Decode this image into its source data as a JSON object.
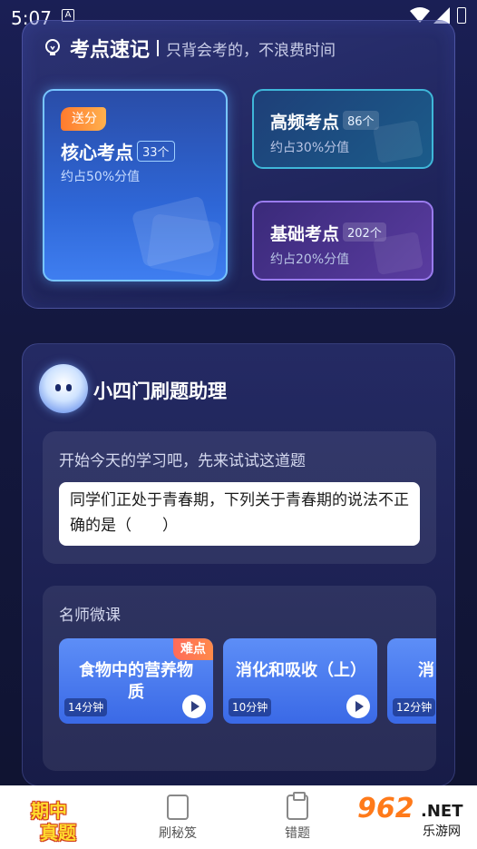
{
  "status_bar": {
    "time": "5:07",
    "notification_icon": "A"
  },
  "quick_memo": {
    "title": "考点速记",
    "subtitle": "只背会考的，不浪费时间",
    "core": {
      "badge": "送分",
      "title": "核心考点",
      "count": "33个",
      "desc": "约占50%分值"
    },
    "high_freq": {
      "title": "高频考点",
      "count": "86个",
      "desc": "约占30%分值"
    },
    "basic": {
      "title": "基础考点",
      "count": "202个",
      "desc": "约占20%分值"
    }
  },
  "assistant": {
    "title": "小四门刷题助理",
    "prompt": "开始今天的学习吧，先来试试这道题",
    "question": "同学们正处于青春期，下列关于青春期的说法不正确的是（　　）"
  },
  "courses": {
    "heading": "名师微课",
    "items": [
      {
        "title": "食物中的营养物质",
        "duration": "14分钟",
        "tag": "难点"
      },
      {
        "title": "消化和吸收（上）",
        "duration": "10分钟",
        "tag": ""
      },
      {
        "title": "消",
        "duration": "12分钟",
        "tag": ""
      }
    ]
  },
  "tabbar": {
    "logo_line1": "期中",
    "logo_line2": "真题",
    "tab2": "刷秘笈",
    "tab3": "错题"
  },
  "watermark": {
    "num": "962",
    "net": ".NET",
    "sub": "乐游网"
  },
  "colors": {
    "accent_blue": "#3f7ef0",
    "accent_orange": "#ff7a2e",
    "accent_purple": "#9a7bee"
  }
}
